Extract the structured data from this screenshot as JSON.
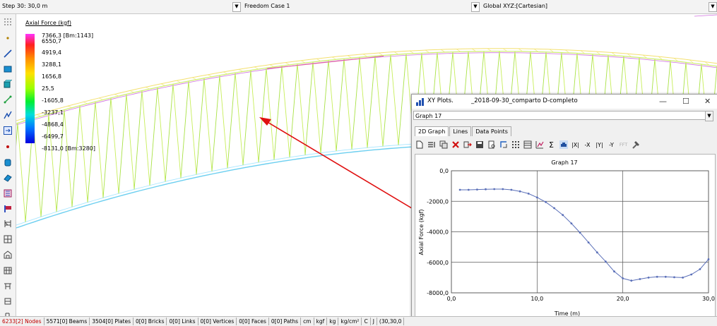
{
  "topbar": {
    "step": "Step 30: 30,0 m",
    "freedom_case": "Freedom Case 1",
    "coordinate_system": "Global XYZ:[Cartesian]"
  },
  "legend": {
    "title": "Axial Force  (kgf)",
    "values": [
      "7366,3 [Bm:1143]",
      "6550,7",
      "4919,4",
      "3288,1",
      "1656,8",
      "25,5",
      "-1605,8",
      "-3237,1",
      "-4868,4",
      "-6499,7",
      "-8131,0 [Bm:3280]"
    ]
  },
  "status_bar": [
    "6233[2] Nodes",
    "5571[0] Beams",
    "3504[0] Plates",
    "0[0] Bricks",
    "0[0] Links",
    "0[0] Vertices",
    "0[0] Faces",
    "0[0] Paths",
    "cm",
    "kgf",
    "kg",
    "kg/cm²",
    "C",
    "J",
    "(30,30,0"
  ],
  "plot_window": {
    "app_title": "XY Plots.",
    "file_title": "_2018-09-30_comparto D-completo",
    "minimize": "—",
    "maximize": "☐",
    "close": "✕",
    "graph_selector": "Graph  17",
    "tabs": [
      "2D Graph",
      "Lines",
      "Data Points"
    ],
    "toolbar_labels": {
      "x_abs": "|X|",
      "x_neg": "-X",
      "y_abs": "|Y|",
      "y_neg": "-Y",
      "fft": "FFT",
      "sigma": "Σ"
    }
  },
  "chart_data": {
    "type": "line",
    "title": "Graph  17",
    "xlabel": "Time (m)",
    "ylabel": "Axial Force (kgf)",
    "xlim": [
      0,
      30
    ],
    "ylim": [
      -8000,
      0
    ],
    "xticks": [
      0,
      10,
      20,
      30
    ],
    "xtick_labels": [
      "0,0",
      "10,0",
      "20,0",
      "30,0"
    ],
    "yticks": [
      0,
      -2000,
      -4000,
      -6000,
      -8000
    ],
    "ytick_labels": [
      "0,0",
      "-2000,0",
      "-4000,0",
      "-6000,0",
      "-8000,0"
    ],
    "grid": true,
    "color": "#5a6fb8",
    "x": [
      1,
      2,
      3,
      4,
      5,
      6,
      7,
      8,
      9,
      10,
      11,
      12,
      13,
      14,
      15,
      16,
      17,
      18,
      19,
      20,
      21,
      22,
      23,
      24,
      25,
      26,
      27,
      28,
      29,
      30
    ],
    "y": [
      -1250,
      -1250,
      -1230,
      -1210,
      -1200,
      -1200,
      -1250,
      -1350,
      -1500,
      -1750,
      -2050,
      -2450,
      -2900,
      -3450,
      -4050,
      -4700,
      -5350,
      -5950,
      -6600,
      -7050,
      -7200,
      -7100,
      -7000,
      -6950,
      -6950,
      -6980,
      -7000,
      -6800,
      -6450,
      -5800
    ]
  }
}
